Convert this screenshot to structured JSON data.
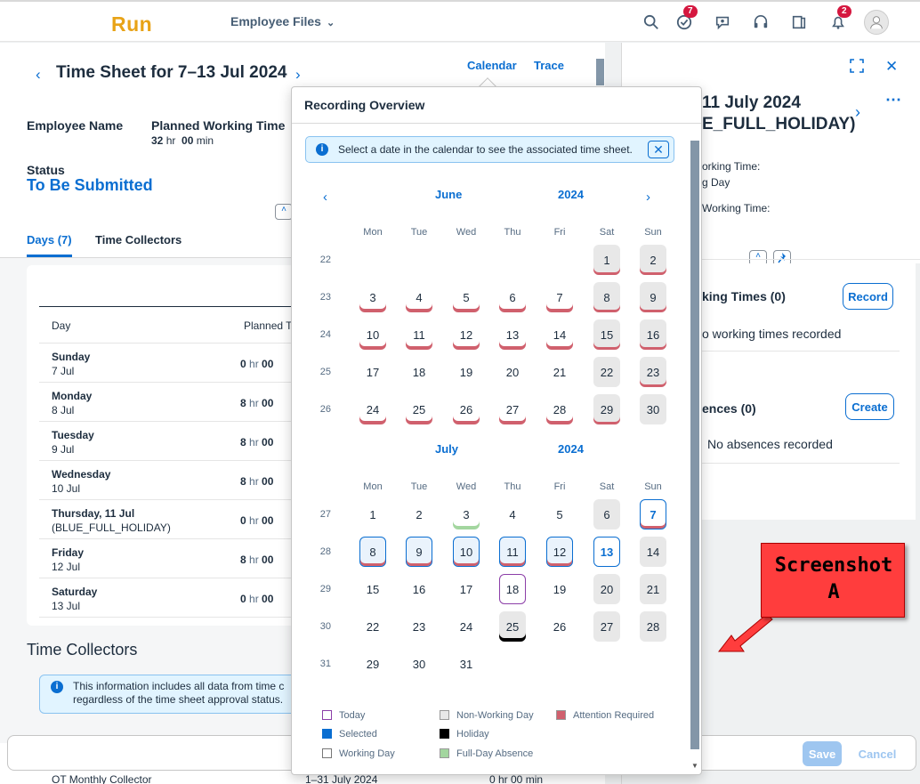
{
  "shell": {
    "logo": "Run",
    "app_menu": "Employee Files",
    "tasks_badge": "7",
    "notif_badge": "2"
  },
  "sheet": {
    "title": "Time Sheet for 7–13 Jul 2024",
    "link_calendar": "Calendar",
    "link_trace": "Trace",
    "employee_name_label": "Employee Name",
    "planned_label": "Planned Working Time",
    "planned_hr": "32",
    "planned_hr_unit": "hr",
    "planned_min": "00",
    "planned_min_unit": "min",
    "status_label": "Status",
    "status_value": "To Be Submitted",
    "tabs": [
      {
        "label": "Days (7)"
      },
      {
        "label": "Time Collectors"
      }
    ],
    "table_head": {
      "day": "Day",
      "planned": "Planned T"
    },
    "rows": [
      {
        "name": "Sunday",
        "date": "7 Jul",
        "hr": "0",
        "min": "00"
      },
      {
        "name": "Monday",
        "date": "8 Jul",
        "hr": "8",
        "min": "00"
      },
      {
        "name": "Tuesday",
        "date": "9 Jul",
        "hr": "8",
        "min": "00"
      },
      {
        "name": "Wednesday",
        "date": "10 Jul",
        "hr": "8",
        "min": "00"
      },
      {
        "name": "Thursday, 11 Jul",
        "date": "(BLUE_FULL_HOLIDAY)",
        "hr": "0",
        "min": "00"
      },
      {
        "name": "Friday",
        "date": "12 Jul",
        "hr": "8",
        "min": "00"
      },
      {
        "name": "Saturday",
        "date": "13 Jul",
        "hr": "0",
        "min": "00"
      }
    ],
    "hr_unit": "hr",
    "tc_title": "Time Collectors",
    "tc_info": "This information includes all data from time c regardless of the time sheet approval status.",
    "bottom_row": {
      "name": "OT Monthly Collector",
      "period": "1–31 July 2024",
      "value": "0 hr 00 min"
    }
  },
  "right": {
    "title_line1": "11 July 2024",
    "title_line2": "E_FULL_HOLIDAY)",
    "planned_frag": "orking Time:",
    "planned_frag2": "g Day",
    "recorded_frag": "Working Time:",
    "working_times": "king Times (0)",
    "record_btn": "Record",
    "no_working": "o working times recorded",
    "absences": "ences (0)",
    "create_btn": "Create",
    "no_absences": "No absences recorded"
  },
  "popover": {
    "title": "Recording Overview",
    "info": "Select a date in the calendar to see the associated time sheet.",
    "weekdays": [
      "Mon",
      "Tue",
      "Wed",
      "Thu",
      "Fri",
      "Sat",
      "Sun"
    ],
    "months": [
      {
        "month": "June",
        "year": "2024",
        "weeks": [
          {
            "wk": "22",
            "days": [
              null,
              null,
              null,
              null,
              null,
              {
                "d": "1",
                "s": "nonwork att"
              },
              {
                "d": "2",
                "s": "nonwork att"
              }
            ]
          },
          {
            "wk": "23",
            "days": [
              {
                "d": "3",
                "s": "att2"
              },
              {
                "d": "4",
                "s": "att2"
              },
              {
                "d": "5",
                "s": "att2"
              },
              {
                "d": "6",
                "s": "att2"
              },
              {
                "d": "7",
                "s": "att2"
              },
              {
                "d": "8",
                "s": "nonwork att"
              },
              {
                "d": "9",
                "s": "nonwork att"
              }
            ]
          },
          {
            "wk": "24",
            "days": [
              {
                "d": "10",
                "s": "att2"
              },
              {
                "d": "11",
                "s": "att2"
              },
              {
                "d": "12",
                "s": "att2"
              },
              {
                "d": "13",
                "s": "att2"
              },
              {
                "d": "14",
                "s": "att2"
              },
              {
                "d": "15",
                "s": "nonwork att"
              },
              {
                "d": "16",
                "s": "nonwork att"
              }
            ]
          },
          {
            "wk": "25",
            "days": [
              {
                "d": "17",
                "s": ""
              },
              {
                "d": "18",
                "s": ""
              },
              {
                "d": "19",
                "s": ""
              },
              {
                "d": "20",
                "s": ""
              },
              {
                "d": "21",
                "s": ""
              },
              {
                "d": "22",
                "s": "nonwork"
              },
              {
                "d": "23",
                "s": "nonwork att"
              }
            ]
          },
          {
            "wk": "26",
            "days": [
              {
                "d": "24",
                "s": "att2"
              },
              {
                "d": "25",
                "s": "att2"
              },
              {
                "d": "26",
                "s": "att2"
              },
              {
                "d": "27",
                "s": "att2"
              },
              {
                "d": "28",
                "s": "att2"
              },
              {
                "d": "29",
                "s": "nonwork att"
              },
              {
                "d": "30",
                "s": "nonwork"
              }
            ]
          }
        ]
      },
      {
        "month": "July",
        "year": "2024",
        "weeks": [
          {
            "wk": "27",
            "days": [
              {
                "d": "1",
                "s": ""
              },
              {
                "d": "2",
                "s": ""
              },
              {
                "d": "3",
                "s": "absence"
              },
              {
                "d": "4",
                "s": ""
              },
              {
                "d": "5",
                "s": ""
              },
              {
                "d": "6",
                "s": "nonwork"
              },
              {
                "d": "7",
                "s": "sel-plain att"
              }
            ]
          },
          {
            "wk": "28",
            "days": [
              {
                "d": "8",
                "s": "sel att"
              },
              {
                "d": "9",
                "s": "sel att"
              },
              {
                "d": "10",
                "s": "sel att"
              },
              {
                "d": "11",
                "s": "sel att"
              },
              {
                "d": "12",
                "s": "sel att"
              },
              {
                "d": "13",
                "s": "sel-plain"
              },
              {
                "d": "14",
                "s": "nonwork"
              }
            ]
          },
          {
            "wk": "29",
            "days": [
              {
                "d": "15",
                "s": ""
              },
              {
                "d": "16",
                "s": ""
              },
              {
                "d": "17",
                "s": ""
              },
              {
                "d": "18",
                "s": "today"
              },
              {
                "d": "19",
                "s": ""
              },
              {
                "d": "20",
                "s": "nonwork"
              },
              {
                "d": "21",
                "s": "nonwork"
              }
            ]
          },
          {
            "wk": "30",
            "days": [
              {
                "d": "22",
                "s": ""
              },
              {
                "d": "23",
                "s": ""
              },
              {
                "d": "24",
                "s": ""
              },
              {
                "d": "25",
                "s": "nonwork holiday"
              },
              {
                "d": "26",
                "s": ""
              },
              {
                "d": "27",
                "s": "nonwork"
              },
              {
                "d": "28",
                "s": "nonwork"
              }
            ]
          },
          {
            "wk": "31",
            "days": [
              {
                "d": "29",
                "s": ""
              },
              {
                "d": "30",
                "s": ""
              },
              {
                "d": "31",
                "s": ""
              },
              null,
              null,
              null,
              null
            ]
          }
        ]
      }
    ],
    "legend": [
      {
        "label": "Today",
        "color": "#ffffff",
        "border": "#8c3fa8"
      },
      {
        "label": "Non-Working Day",
        "color": "#e8e8e8",
        "border": "#999999"
      },
      {
        "label": "Attention Required",
        "color": "#d0606d",
        "border": "#999999"
      },
      {
        "label": "Selected",
        "color": "#0a6ed1",
        "border": "#0a6ed1"
      },
      {
        "label": "Holiday",
        "color": "#000000",
        "border": "#000000"
      },
      {
        "label": "Working Day",
        "color": "#ffffff",
        "border": "#777777"
      },
      {
        "label": "Full-Day Absence",
        "color": "#a3d69f",
        "border": "#999999"
      }
    ]
  },
  "footer": {
    "save": "Save",
    "cancel": "Cancel"
  },
  "annotation": {
    "line1": "Screenshot",
    "line2": "A"
  }
}
